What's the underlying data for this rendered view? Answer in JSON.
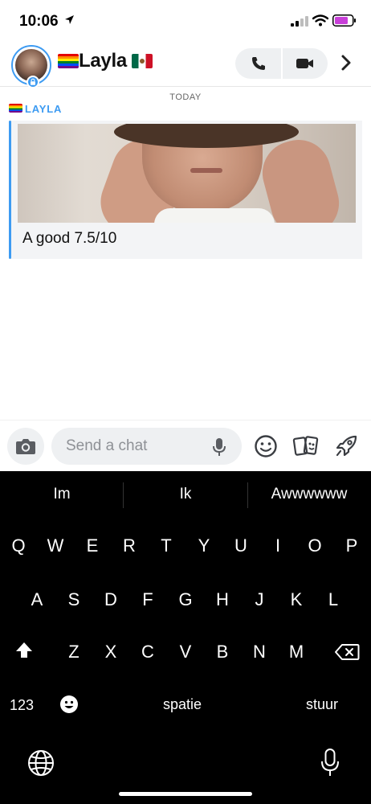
{
  "status_bar": {
    "time": "10:06",
    "icons": [
      "location-arrow-icon",
      "signal-icon",
      "wifi-icon",
      "battery-icon"
    ],
    "battery_color": "#c83fd8"
  },
  "header": {
    "contact_name": "Layla",
    "name_emoji_left": "rainbow-flag",
    "name_emoji_right": "mexico-flag",
    "accent_color": "#3d9bf2"
  },
  "chat": {
    "date_divider": "TODAY",
    "sender_label": "LAYLA",
    "messages": [
      {
        "type": "snap-reply",
        "caption": "A good 7.5/10"
      }
    ]
  },
  "composer": {
    "placeholder": "Send a chat"
  },
  "keyboard": {
    "suggestions": [
      "Im",
      "Ik",
      "Awwwwww"
    ],
    "row1": [
      "Q",
      "W",
      "E",
      "R",
      "T",
      "Y",
      "U",
      "I",
      "O",
      "P"
    ],
    "row2": [
      "A",
      "S",
      "D",
      "F",
      "G",
      "H",
      "J",
      "K",
      "L"
    ],
    "row3": [
      "Z",
      "X",
      "C",
      "V",
      "B",
      "N",
      "M"
    ],
    "numbers_label": "123",
    "space_label": "spatie",
    "return_label": "stuur"
  }
}
